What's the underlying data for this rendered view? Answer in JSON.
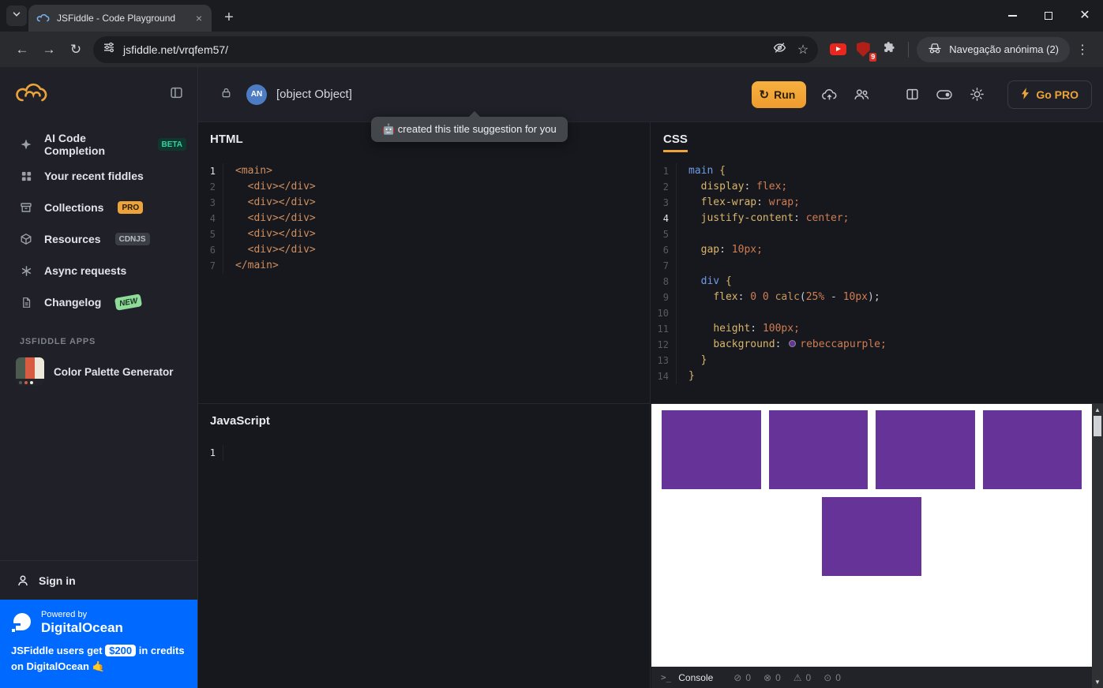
{
  "browser": {
    "tab_title": "JSFiddle - Code Playground",
    "url": "jsfiddle.net/vrqfem57/",
    "incognito_label": "Navegação anónima (2)",
    "ublock_badge": "9"
  },
  "header": {
    "title": "[object Object]",
    "avatar_initials": "AN",
    "run_label": "Run",
    "go_pro_label": "Go PRO",
    "tooltip_text": "🤖 created this title suggestion for you"
  },
  "sidebar": {
    "items": [
      {
        "id": "ai-code-completion",
        "label": "AI Code Completion",
        "icon": "sparkle-icon",
        "badge": "BETA",
        "badge_type": "beta"
      },
      {
        "id": "recent-fiddles",
        "label": "Your recent fiddles",
        "icon": "grid-icon"
      },
      {
        "id": "collections",
        "label": "Collections",
        "icon": "archive-icon",
        "badge": "PRO",
        "badge_type": "pro"
      },
      {
        "id": "resources",
        "label": "Resources",
        "icon": "cube-icon",
        "badge": "CDNJS",
        "badge_type": "cdnjs"
      },
      {
        "id": "async-requests",
        "label": "Async requests",
        "icon": "asterisk-icon"
      },
      {
        "id": "changelog",
        "label": "Changelog",
        "icon": "document-icon",
        "badge": "NEW",
        "badge_type": "new"
      }
    ],
    "apps_header": "JSFIDDLE APPS",
    "apps": [
      {
        "label": "Color Palette Generator"
      }
    ],
    "sign_in": "Sign in",
    "promo": {
      "powered_by": "Powered by",
      "brand": "DigitalOcean",
      "text_pre": "JSFiddle users get",
      "credit": "$200",
      "text_mid": "in credits on DigitalOcean 🤙"
    }
  },
  "editors": {
    "html": {
      "title": "HTML",
      "lines": [
        {
          "n": "1",
          "active": true,
          "t": [
            [
              "tag",
              "<main>"
            ]
          ]
        },
        {
          "n": "2",
          "t": [
            [
              "pl",
              "  "
            ],
            [
              "tag",
              "<div></div>"
            ]
          ]
        },
        {
          "n": "3",
          "t": [
            [
              "pl",
              "  "
            ],
            [
              "tag",
              "<div></div>"
            ]
          ]
        },
        {
          "n": "4",
          "t": [
            [
              "pl",
              "  "
            ],
            [
              "tag",
              "<div></div>"
            ]
          ]
        },
        {
          "n": "5",
          "t": [
            [
              "pl",
              "  "
            ],
            [
              "tag",
              "<div></div>"
            ]
          ]
        },
        {
          "n": "6",
          "t": [
            [
              "pl",
              "  "
            ],
            [
              "tag",
              "<div></div>"
            ]
          ]
        },
        {
          "n": "7",
          "t": [
            [
              "tag",
              "</main>"
            ]
          ]
        }
      ]
    },
    "css": {
      "title": "CSS",
      "lines": [
        {
          "n": "1",
          "t": [
            [
              "sel",
              "main"
            ],
            [
              "pl",
              " "
            ],
            [
              "br",
              "{"
            ]
          ]
        },
        {
          "n": "2",
          "t": [
            [
              "pl",
              "  "
            ],
            [
              "pr",
              "display"
            ],
            [
              "pl",
              ": "
            ],
            [
              "va",
              "flex;"
            ]
          ]
        },
        {
          "n": "3",
          "t": [
            [
              "pl",
              "  "
            ],
            [
              "pr",
              "flex-wrap"
            ],
            [
              "pl",
              ": "
            ],
            [
              "va",
              "wrap;"
            ]
          ]
        },
        {
          "n": "4",
          "active": true,
          "t": [
            [
              "pl",
              "  "
            ],
            [
              "pr",
              "justify-content"
            ],
            [
              "pl",
              ": "
            ],
            [
              "va",
              "center;"
            ]
          ]
        },
        {
          "n": "5",
          "t": []
        },
        {
          "n": "6",
          "t": [
            [
              "pl",
              "  "
            ],
            [
              "pr",
              "gap"
            ],
            [
              "pl",
              ": "
            ],
            [
              "va",
              "10px;"
            ]
          ]
        },
        {
          "n": "7",
          "t": []
        },
        {
          "n": "8",
          "t": [
            [
              "pl",
              "  "
            ],
            [
              "sel",
              "div"
            ],
            [
              "pl",
              " "
            ],
            [
              "br",
              "{"
            ]
          ]
        },
        {
          "n": "9",
          "t": [
            [
              "pl",
              "    "
            ],
            [
              "pr",
              "flex"
            ],
            [
              "pl",
              ": "
            ],
            [
              "va",
              "0 0 "
            ],
            [
              "fn",
              "calc"
            ],
            [
              "pl",
              "("
            ],
            [
              "va",
              "25%"
            ],
            [
              "pl",
              " - "
            ],
            [
              "va",
              "10px"
            ],
            [
              "pl",
              ");"
            ]
          ]
        },
        {
          "n": "10",
          "t": []
        },
        {
          "n": "11",
          "t": [
            [
              "pl",
              "    "
            ],
            [
              "pr",
              "height"
            ],
            [
              "pl",
              ": "
            ],
            [
              "va",
              "100px;"
            ]
          ]
        },
        {
          "n": "12",
          "t": [
            [
              "pl",
              "    "
            ],
            [
              "pr",
              "background"
            ],
            [
              "pl",
              ": "
            ],
            [
              "sw",
              ""
            ],
            [
              "va",
              "rebeccapurple;"
            ]
          ]
        },
        {
          "n": "13",
          "t": [
            [
              "pl",
              "  "
            ],
            [
              "br",
              "}"
            ]
          ]
        },
        {
          "n": "14",
          "t": [
            [
              "br",
              "}"
            ]
          ]
        }
      ]
    },
    "javascript": {
      "title": "JavaScript",
      "lines": [
        {
          "n": "1",
          "active": true,
          "t": []
        }
      ]
    }
  },
  "result": {
    "box_count": 5,
    "box_color": "#663399"
  },
  "console": {
    "prompt": ">_",
    "label": "Console",
    "counters": [
      {
        "name": "console-error-count",
        "glyph": "⊘",
        "value": "0"
      },
      {
        "name": "console-blocked-count",
        "glyph": "⊗",
        "value": "0"
      },
      {
        "name": "console-warning-count",
        "glyph": "⚠",
        "value": "0"
      },
      {
        "name": "console-info-count",
        "glyph": "⊙",
        "value": "0"
      }
    ]
  }
}
